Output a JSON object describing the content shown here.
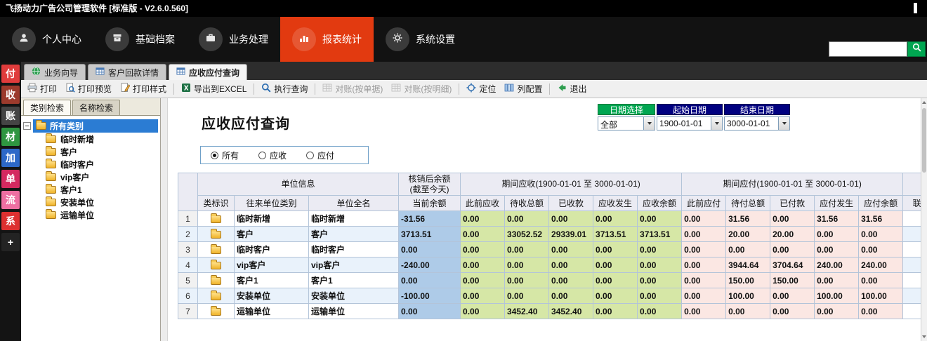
{
  "window": {
    "title": "飞扬动力广告公司管理软件 [标准版 - V2.6.0.560]"
  },
  "colors": {
    "accent": "#e23a10",
    "green": "#00a651",
    "navy": "#000080",
    "selection_blue": "#2b7cd3",
    "balance_bg": "#aecbe8",
    "receivable_bg": "#d6e7a6",
    "payable_bg": "#fbe7e3"
  },
  "navbar": {
    "items": [
      {
        "key": "personal-center",
        "label": "个人中心",
        "icon": "user-icon",
        "active": false
      },
      {
        "key": "base-archives",
        "label": "基础档案",
        "icon": "archive-icon",
        "active": false
      },
      {
        "key": "business-process",
        "label": "业务处理",
        "icon": "briefcase-icon",
        "active": false
      },
      {
        "key": "report-statistics",
        "label": "报表统计",
        "icon": "chart-icon",
        "active": true
      },
      {
        "key": "system-settings",
        "label": "系统设置",
        "icon": "gear-icon",
        "active": false
      }
    ]
  },
  "tabbar": {
    "tabs": [
      {
        "key": "business-wizard",
        "label": "业务向导",
        "icon": "globe-icon",
        "active": false
      },
      {
        "key": "customer-payment-detail",
        "label": "客户回款详情",
        "icon": "table-icon",
        "active": false
      },
      {
        "key": "receivable-payable-query",
        "label": "应收应付查询",
        "icon": "table-icon",
        "active": true
      }
    ]
  },
  "toolbar": {
    "items": [
      {
        "key": "print",
        "label": "打印",
        "icon": "print-icon",
        "enabled": true,
        "sep_after": false
      },
      {
        "key": "print-preview",
        "label": "打印预览",
        "icon": "preview-icon",
        "enabled": true,
        "sep_after": false
      },
      {
        "key": "print-style",
        "label": "打印样式",
        "icon": "style-icon",
        "enabled": true,
        "sep_after": true
      },
      {
        "key": "export-excel",
        "label": "导出到EXCEL",
        "icon": "excel-icon",
        "enabled": true,
        "sep_after": true
      },
      {
        "key": "run-query",
        "label": "执行查询",
        "icon": "search-icon",
        "enabled": true,
        "sep_after": true
      },
      {
        "key": "reconcile-by-doc",
        "label": "对账(按单据)",
        "icon": "grid-icon",
        "enabled": false,
        "sep_after": false
      },
      {
        "key": "reconcile-by-detail",
        "label": "对账(按明细)",
        "icon": "grid-icon",
        "enabled": false,
        "sep_after": true
      },
      {
        "key": "locate",
        "label": "定位",
        "icon": "locate-icon",
        "enabled": true,
        "sep_after": false
      },
      {
        "key": "column-config",
        "label": "列配置",
        "icon": "columns-icon",
        "enabled": true,
        "sep_after": true
      },
      {
        "key": "exit",
        "label": "退出",
        "icon": "exit-icon",
        "enabled": true,
        "sep_after": false
      }
    ]
  },
  "sidestrip": {
    "items": [
      {
        "key": "pay",
        "label": "付",
        "color": "#e03c3c"
      },
      {
        "key": "receive",
        "label": "收",
        "color": "#9c3a2c"
      },
      {
        "key": "account",
        "label": "账",
        "color": "#454545"
      },
      {
        "key": "material",
        "label": "材",
        "color": "#2f9640"
      },
      {
        "key": "add",
        "label": "加",
        "color": "#2d68c8"
      },
      {
        "key": "order",
        "label": "单",
        "color": "#d42960"
      },
      {
        "key": "flow",
        "label": "流",
        "color": "#ee6fa2"
      },
      {
        "key": "system",
        "label": "系",
        "color": "#dd3030"
      },
      {
        "key": "plus",
        "label": "+",
        "color": "#232323"
      }
    ]
  },
  "left_panel": {
    "tabs": [
      {
        "key": "category-search",
        "label": "类别检索",
        "active": true
      },
      {
        "key": "name-search",
        "label": "名称检索",
        "active": false
      }
    ],
    "tree": {
      "root": {
        "label": "所有类别",
        "selected": true
      },
      "children": [
        {
          "key": "temp-new",
          "label": "临时新增"
        },
        {
          "key": "customer",
          "label": "客户"
        },
        {
          "key": "temp-customer",
          "label": "临时客户"
        },
        {
          "key": "vip-customer",
          "label": "vip客户"
        },
        {
          "key": "customer1",
          "label": "客户1"
        },
        {
          "key": "install-unit",
          "label": "安装单位"
        },
        {
          "key": "transport-unit",
          "label": "运输单位"
        }
      ]
    }
  },
  "main": {
    "title": "应收应付查询",
    "date_filter": {
      "period_label": "日期选择",
      "period_value": "全部",
      "start_label": "起始日期",
      "start_value": "1900-01-01",
      "end_label": "结束日期",
      "end_value": "3000-01-01"
    },
    "filter_radios": {
      "options": [
        {
          "key": "all",
          "label": "所有"
        },
        {
          "key": "receivable",
          "label": "应收"
        },
        {
          "key": "payable",
          "label": "应付"
        }
      ],
      "selected": "all"
    },
    "table": {
      "group_headers": [
        {
          "label": "单位信息",
          "colspan": 3
        },
        {
          "label": "核销后余额\n(截至今天)",
          "colspan": 1
        },
        {
          "label": "期间应收(1900-01-01 至 3000-01-01)",
          "colspan": 5
        },
        {
          "label": "期间应付(1900-01-01 至 3000-01-01)",
          "colspan": 5
        },
        {
          "label": "",
          "colspan": 1
        }
      ],
      "columns": [
        "类标识",
        "往来单位类别",
        "单位全名",
        "当前余额",
        "此前应收",
        "待收总额",
        "已收款",
        "应收发生",
        "应收余额",
        "此前应付",
        "待付总额",
        "已付款",
        "应付发生",
        "应付余额",
        "联"
      ],
      "rows": [
        {
          "num": 1,
          "category": "临时新增",
          "name": "临时新增",
          "balance": "-31.56",
          "recv": [
            "0.00",
            "0.00",
            "0.00",
            "0.00",
            "0.00"
          ],
          "pay": [
            "0.00",
            "31.56",
            "0.00",
            "31.56",
            "31.56"
          ]
        },
        {
          "num": 2,
          "category": "客户",
          "name": "客户",
          "balance": "3713.51",
          "recv": [
            "0.00",
            "33052.52",
            "29339.01",
            "3713.51",
            "3713.51"
          ],
          "pay": [
            "0.00",
            "20.00",
            "20.00",
            "0.00",
            "0.00"
          ]
        },
        {
          "num": 3,
          "category": "临时客户",
          "name": "临时客户",
          "balance": "0.00",
          "recv": [
            "0.00",
            "0.00",
            "0.00",
            "0.00",
            "0.00"
          ],
          "pay": [
            "0.00",
            "0.00",
            "0.00",
            "0.00",
            "0.00"
          ]
        },
        {
          "num": 4,
          "category": "vip客户",
          "name": "vip客户",
          "balance": "-240.00",
          "recv": [
            "0.00",
            "0.00",
            "0.00",
            "0.00",
            "0.00"
          ],
          "pay": [
            "0.00",
            "3944.64",
            "3704.64",
            "240.00",
            "240.00"
          ]
        },
        {
          "num": 5,
          "category": "客户1",
          "name": "客户1",
          "balance": "0.00",
          "recv": [
            "0.00",
            "0.00",
            "0.00",
            "0.00",
            "0.00"
          ],
          "pay": [
            "0.00",
            "150.00",
            "150.00",
            "0.00",
            "0.00"
          ]
        },
        {
          "num": 6,
          "category": "安装单位",
          "name": "安装单位",
          "balance": "-100.00",
          "recv": [
            "0.00",
            "0.00",
            "0.00",
            "0.00",
            "0.00"
          ],
          "pay": [
            "0.00",
            "100.00",
            "0.00",
            "100.00",
            "100.00"
          ]
        },
        {
          "num": 7,
          "category": "运输单位",
          "name": "运输单位",
          "balance": "0.00",
          "recv": [
            "0.00",
            "3452.40",
            "3452.40",
            "0.00",
            "0.00"
          ],
          "pay": [
            "0.00",
            "0.00",
            "0.00",
            "0.00",
            "0.00"
          ]
        }
      ]
    }
  }
}
